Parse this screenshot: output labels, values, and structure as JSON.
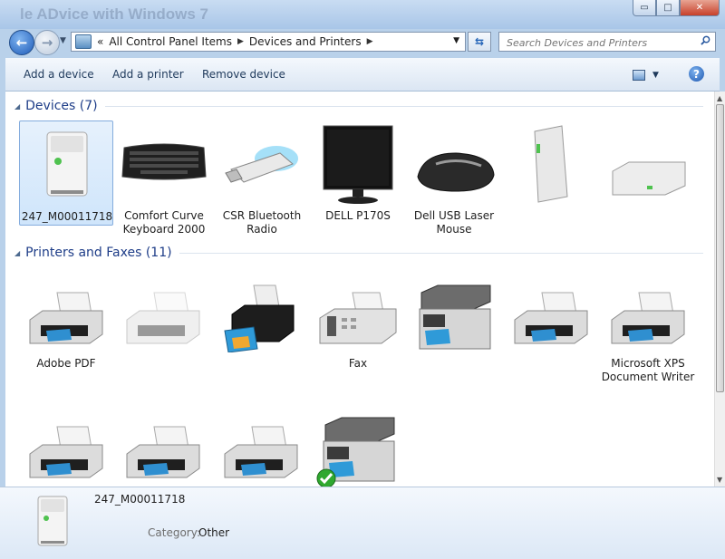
{
  "window": {
    "bg_title": "le ADvice with Windows 7",
    "minimize_label": "▭",
    "maximize_label": "□",
    "close_label": "✕"
  },
  "address": {
    "overflow": "«",
    "crumbs": [
      "All Control Panel Items",
      "Devices and Printers"
    ]
  },
  "search": {
    "placeholder": "Search Devices and Printers"
  },
  "toolbar": {
    "add_device": "Add a device",
    "add_printer": "Add a printer",
    "remove_device": "Remove device",
    "help": "?"
  },
  "groups": {
    "devices": {
      "title": "Devices (7)"
    },
    "printers": {
      "title": "Printers and Faxes (11)"
    }
  },
  "devices": [
    {
      "label": "247_M00011718",
      "icon": "tower-computer-icon",
      "selected": true
    },
    {
      "label": "Comfort Curve\nKeyboard 2000",
      "icon": "keyboard-icon"
    },
    {
      "label": "CSR Bluetooth\nRadio",
      "icon": "bluetooth-usb-icon"
    },
    {
      "label": "DELL P170S",
      "icon": "monitor-icon"
    },
    {
      "label": "Dell USB Laser\nMouse",
      "icon": "mouse-icon"
    },
    {
      "label": "",
      "icon": "external-drive-icon"
    },
    {
      "label": "",
      "icon": "hard-drive-icon"
    }
  ],
  "printers": [
    {
      "label": "Adobe PDF",
      "icon": "printer-icon"
    },
    {
      "label": "",
      "icon": "printer-icon"
    },
    {
      "label": "",
      "icon": "inkjet-printer-icon"
    },
    {
      "label": "Fax",
      "icon": "fax-icon"
    },
    {
      "label": "",
      "icon": "multifunction-printer-icon"
    },
    {
      "label": "",
      "icon": "printer-icon"
    },
    {
      "label": "Microsoft XPS\nDocument Writer",
      "icon": "printer-icon"
    },
    {
      "label": "",
      "icon": "printer-icon"
    },
    {
      "label": "",
      "icon": "printer-icon"
    },
    {
      "label": "",
      "icon": "printer-icon"
    },
    {
      "label": "",
      "icon": "multifunction-printer-icon",
      "default": true
    }
  ],
  "details": {
    "name": "247_M00011718",
    "category_label": "Category:",
    "category_value": "Other"
  }
}
